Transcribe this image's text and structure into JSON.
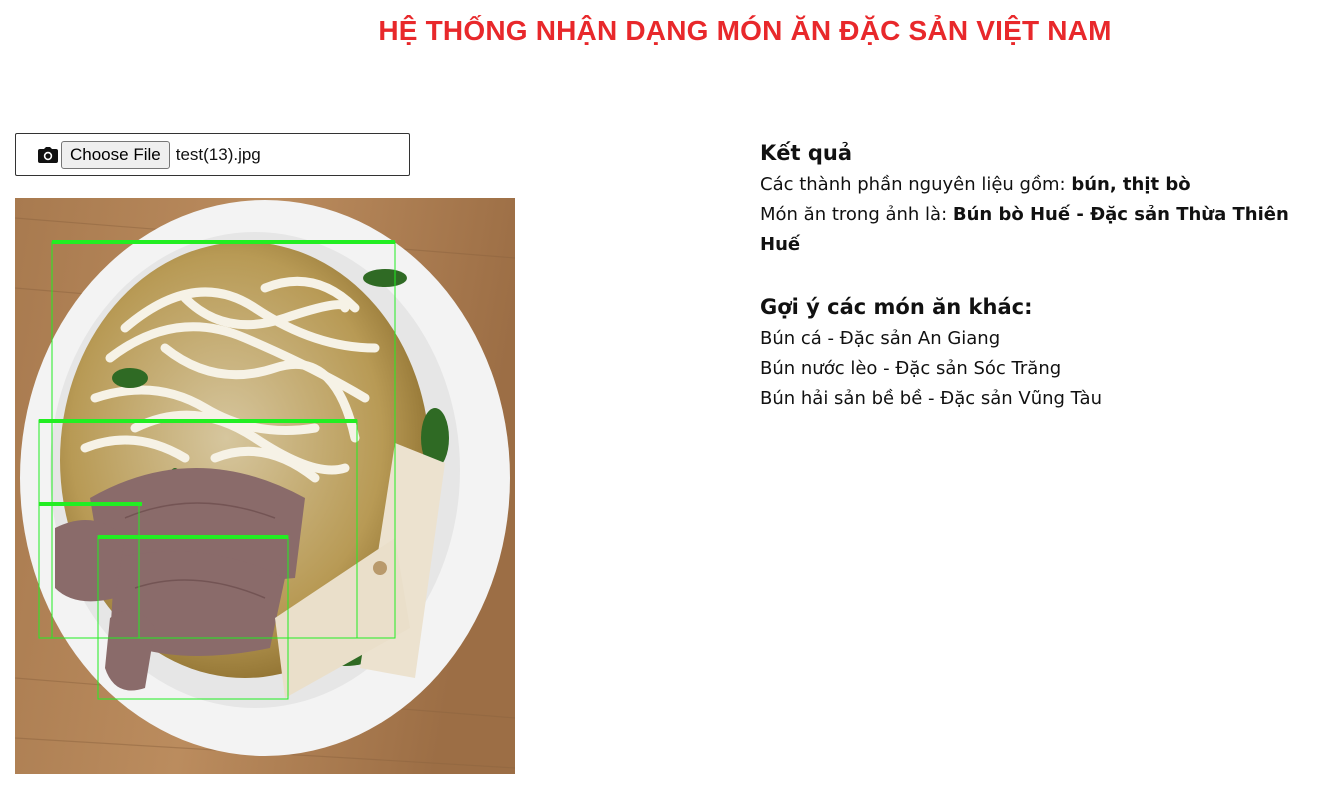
{
  "header": {
    "title": "HỆ THỐNG NHẬN DẠNG MÓN ĂN ĐẶC SẢN VIỆT NAM"
  },
  "upload": {
    "icon": "camera-icon",
    "button_label": "Choose File",
    "file_name": "test(13).jpg"
  },
  "result": {
    "heading": "Kết quả",
    "ingredients_prefix": "Các thành phần nguyên liệu gồm: ",
    "ingredients_value": "bún, thịt bò",
    "dish_prefix": "Món ăn trong ảnh là: ",
    "dish_value": "Bún bò Huế - Đặc sản Thừa Thiên Huế"
  },
  "suggestions": {
    "heading": "Gợi ý các món ăn khác:",
    "items": [
      "Bún cá - Đặc sản An Giang",
      "Bún nước lèo - Đặc sản Sóc Trăng",
      "Bún hải sản bề bề - Đặc sản Vũng Tàu"
    ]
  },
  "detection_colors": {
    "box": "#22ee22",
    "title": "#e8282b"
  }
}
